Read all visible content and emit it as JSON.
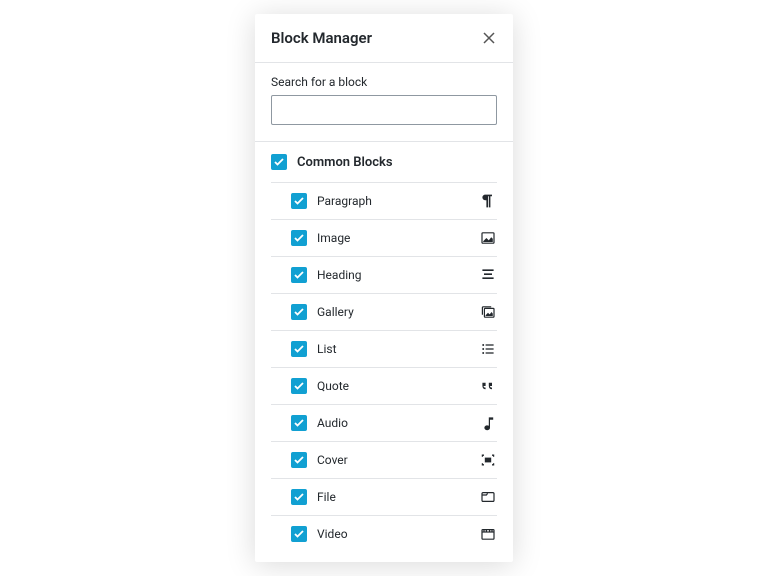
{
  "modal": {
    "title": "Block Manager"
  },
  "search": {
    "label": "Search for a block",
    "value": ""
  },
  "category": {
    "title": "Common Blocks",
    "checked": true
  },
  "blocks": [
    {
      "label": "Paragraph",
      "icon": "paragraph",
      "checked": true
    },
    {
      "label": "Image",
      "icon": "image",
      "checked": true
    },
    {
      "label": "Heading",
      "icon": "heading",
      "checked": true
    },
    {
      "label": "Gallery",
      "icon": "gallery",
      "checked": true
    },
    {
      "label": "List",
      "icon": "list",
      "checked": true
    },
    {
      "label": "Quote",
      "icon": "quote",
      "checked": true
    },
    {
      "label": "Audio",
      "icon": "audio",
      "checked": true
    },
    {
      "label": "Cover",
      "icon": "cover",
      "checked": true
    },
    {
      "label": "File",
      "icon": "file",
      "checked": true
    },
    {
      "label": "Video",
      "icon": "video",
      "checked": true
    }
  ]
}
